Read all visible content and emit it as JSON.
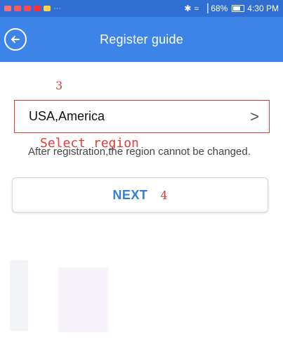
{
  "status_bar": {
    "time": "4:30 PM",
    "battery_percent": "68%",
    "left_icons": [
      "notification-icon-1",
      "mail-icon",
      "chat-icon",
      "app-icon",
      "app-icon-2"
    ],
    "more_dots": "···",
    "bluetooth_glyph": "✱",
    "wifi_glyph": "≈",
    "signal_glyph": "▕"
  },
  "header": {
    "title": "Register guide"
  },
  "annotations": {
    "step_3": "3",
    "select_region": "Select region",
    "step_4": "4"
  },
  "region": {
    "value": "USA,America",
    "chevron": ">"
  },
  "note": "After registration,the region cannot be changed.",
  "next_button": {
    "label": "NEXT"
  },
  "colors": {
    "status_bar": "#2f6fd1",
    "app_bar": "#3d84e8",
    "annotation_red": "#e53935",
    "next_blue": "#2f7ee6"
  }
}
